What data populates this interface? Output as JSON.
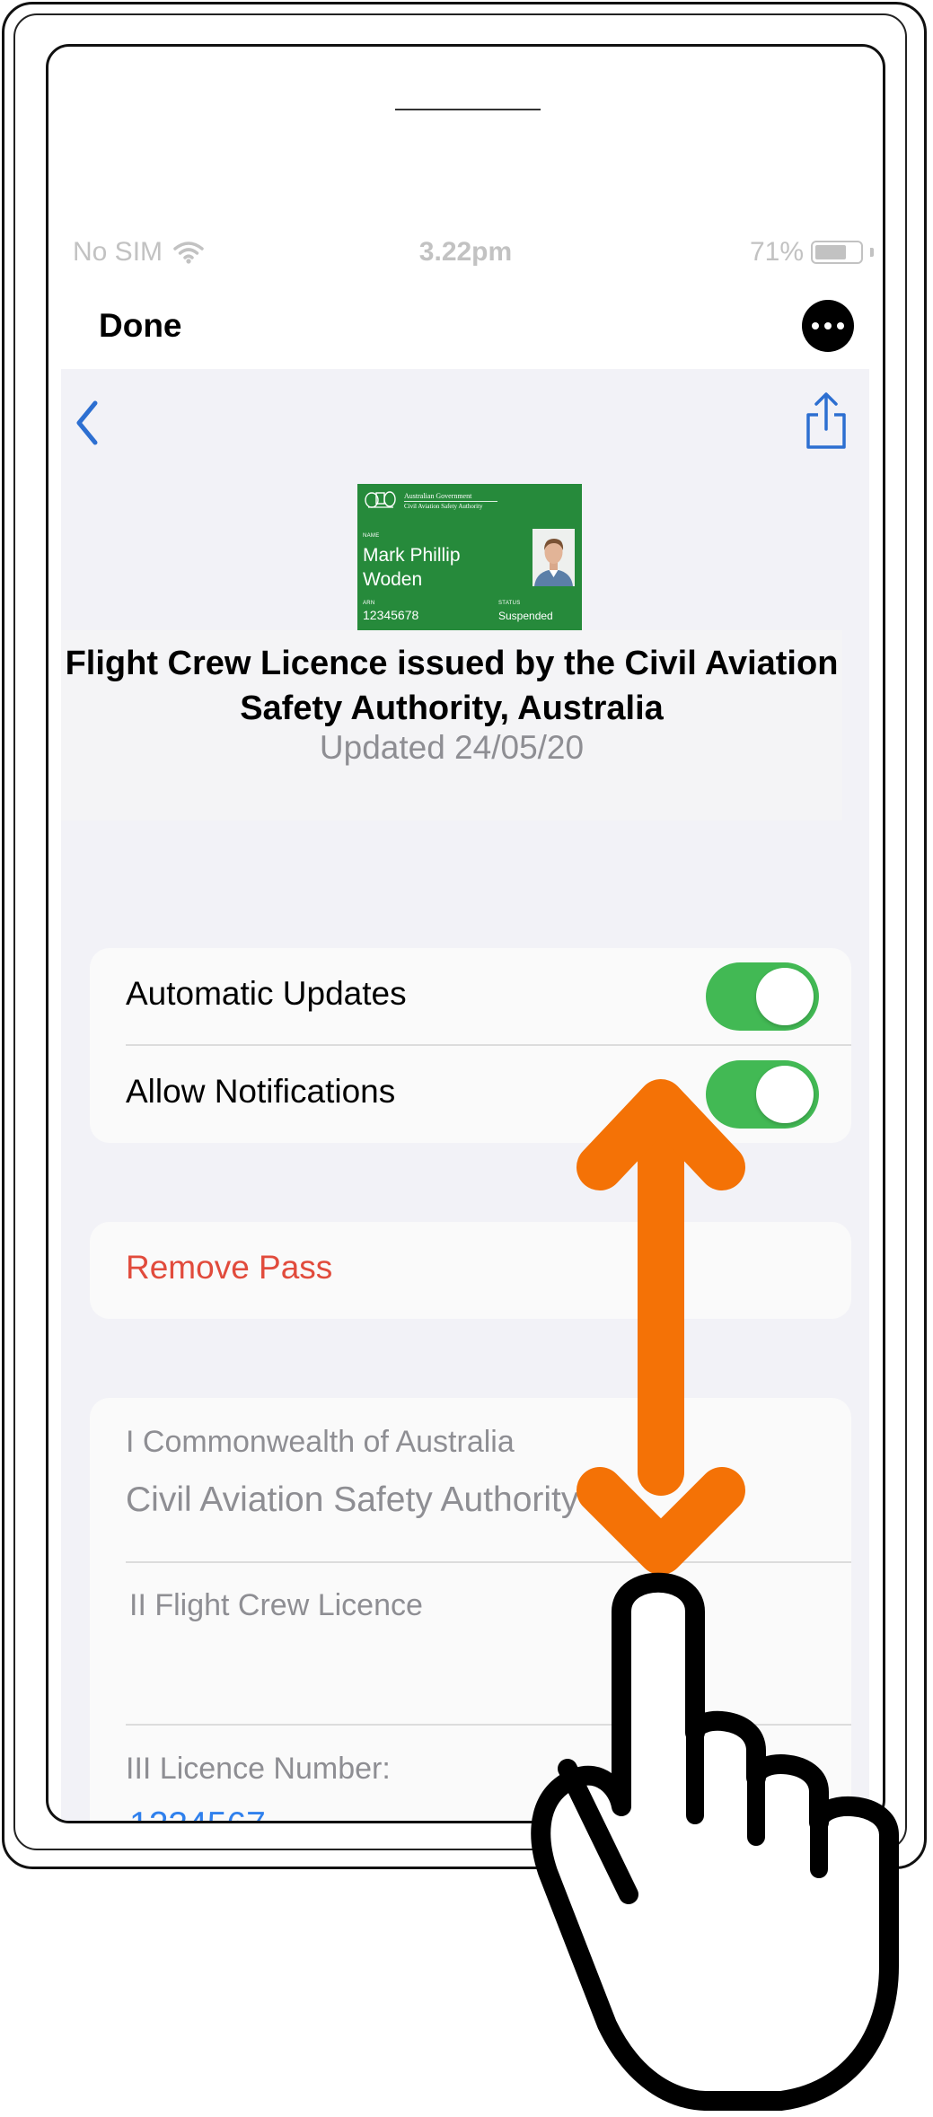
{
  "status_bar": {
    "carrier": "No SIM",
    "time": "3.22pm",
    "battery": "71%",
    "wifi_icon": "wifi-icon",
    "battery_level": 0.71
  },
  "nav": {
    "done_label": "Done",
    "more_icon": "ellipsis-icon",
    "back_icon": "chevron-left-icon",
    "share_icon": "share-icon"
  },
  "card": {
    "gov_line": "Australian Government",
    "agency_line": "Civil Aviation Safety Authority",
    "name_label": "NAME",
    "holder_name": "Mark Phillip Woden",
    "arn_label": "ARN",
    "arn_value": "12345678",
    "status_label": "STATUS",
    "status_value": "Suspended",
    "card_color": "#268a3b"
  },
  "pass": {
    "title": "Flight Crew Licence issued by the Civil Aviation Safety Authority, Australia",
    "updated": "Updated 24/05/20"
  },
  "settings": {
    "automatic_updates_label": "Automatic Updates",
    "automatic_updates_on": true,
    "allow_notifications_label": "Allow Notifications",
    "allow_notifications_on": true,
    "toggle_color": "#42b954"
  },
  "actions": {
    "remove_pass_label": "Remove Pass",
    "remove_color": "#e14b3c"
  },
  "details": {
    "field1_caption": "I Commonwealth of Australia",
    "field1_value": "Civil Aviation Safety Authority",
    "field2_caption": "II Flight Crew Licence",
    "field3_caption": "III Licence Number:",
    "field3_value": "1234567",
    "link_color": "#2f80ed"
  },
  "gesture": {
    "arrow_icon": "double-arrow-vertical-icon",
    "hand_icon": "pointing-hand-icon",
    "arrow_color": "#f47206"
  }
}
